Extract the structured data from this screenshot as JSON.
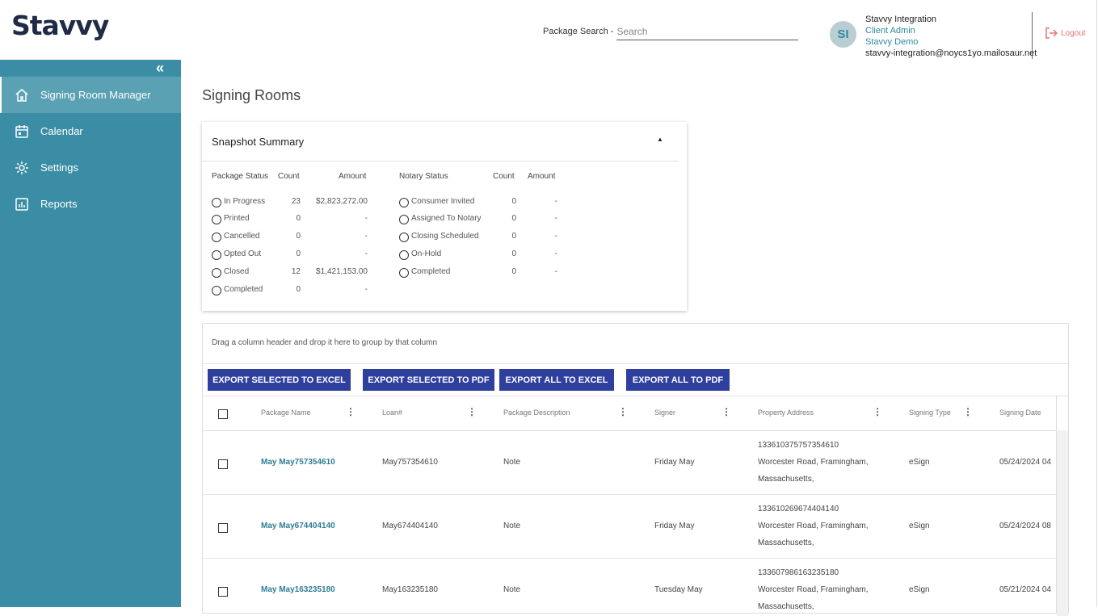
{
  "header": {
    "logo": "Stavvy",
    "search_label": "Package Search -",
    "search_placeholder": "Search",
    "avatar_initials": "SI",
    "user_name": "Stavvy Integration",
    "role": "Client Admin",
    "org": "Stavvy Demo",
    "email": "stavvy-integration@noycs1yo.mailosaur.net",
    "logout": "Logout"
  },
  "sidebar": {
    "collapse": "«",
    "items": [
      {
        "label": "Signing Room Manager",
        "icon": "home-icon",
        "active": true
      },
      {
        "label": "Calendar",
        "icon": "calendar-icon",
        "active": false
      },
      {
        "label": "Settings",
        "icon": "gear-icon",
        "active": false
      },
      {
        "label": "Reports",
        "icon": "chart-icon",
        "active": false
      }
    ]
  },
  "page": {
    "title": "Signing Rooms"
  },
  "snapshot": {
    "title": "Snapshot Summary",
    "toggle": "▲",
    "package_headers": {
      "status": "Package Status",
      "count": "Count",
      "amount": "Amount"
    },
    "notary_headers": {
      "status": "Notary Status",
      "count": "Count",
      "amount": "Amount"
    },
    "package_rows": [
      {
        "label": "In Progress",
        "count": "23",
        "amount": "$2,823,272.00"
      },
      {
        "label": "Printed",
        "count": "0",
        "amount": "-"
      },
      {
        "label": "Cancelled",
        "count": "0",
        "amount": "-"
      },
      {
        "label": "Opted Out",
        "count": "0",
        "amount": "-"
      },
      {
        "label": "Closed",
        "count": "12",
        "amount": "$1,421,153.00"
      },
      {
        "label": "Completed",
        "count": "0",
        "amount": "-"
      }
    ],
    "notary_rows": [
      {
        "label": "Consumer Invited",
        "count": "0",
        "amount": "-"
      },
      {
        "label": "Assigned To Notary",
        "count": "0",
        "amount": "-"
      },
      {
        "label": "Closing Scheduled",
        "count": "0",
        "amount": "-"
      },
      {
        "label": "On-Hold",
        "count": "0",
        "amount": "-"
      },
      {
        "label": "Completed",
        "count": "0",
        "amount": "-"
      }
    ]
  },
  "grid": {
    "group_hint": "Drag a column header and drop it here to group by that column",
    "buttons": {
      "export_selected_excel": "EXPORT SELECTED TO EXCEL",
      "export_selected_pdf": "EXPORT SELECTED TO PDF",
      "export_all_excel": "EXPORT ALL TO EXCEL",
      "export_all_pdf": "EXPORT ALL TO PDF"
    },
    "columns": {
      "package_name": "Package Name",
      "loan": "Loan#",
      "description": "Package Description",
      "signer": "Signer",
      "address": "Property Address",
      "signing_type": "Signing Type",
      "signing_date": "Signing Date"
    },
    "rows": [
      {
        "package_name": "May May757354610",
        "loan": "May757354610",
        "description": "Note",
        "signer": "Friday May",
        "address1": "133610375757354610",
        "address2": "Worcester Road, Framingham,",
        "address3": "Massachusetts,",
        "signing_type": "eSign",
        "signing_date": "05/24/2024 04"
      },
      {
        "package_name": "May May674404140",
        "loan": "May674404140",
        "description": "Note",
        "signer": "Friday May",
        "address1": "133610269674404140",
        "address2": "Worcester Road, Framingham,",
        "address3": "Massachusetts,",
        "signing_type": "eSign",
        "signing_date": "05/24/2024 08"
      },
      {
        "package_name": "May May163235180",
        "loan": "May163235180",
        "description": "Note",
        "signer": "Tuesday May",
        "address1": "133607986163235180",
        "address2": "Worcester Road, Framingham,",
        "address3": "Massachusetts,",
        "signing_type": "eSign",
        "signing_date": "05/21/2024 04"
      }
    ]
  }
}
